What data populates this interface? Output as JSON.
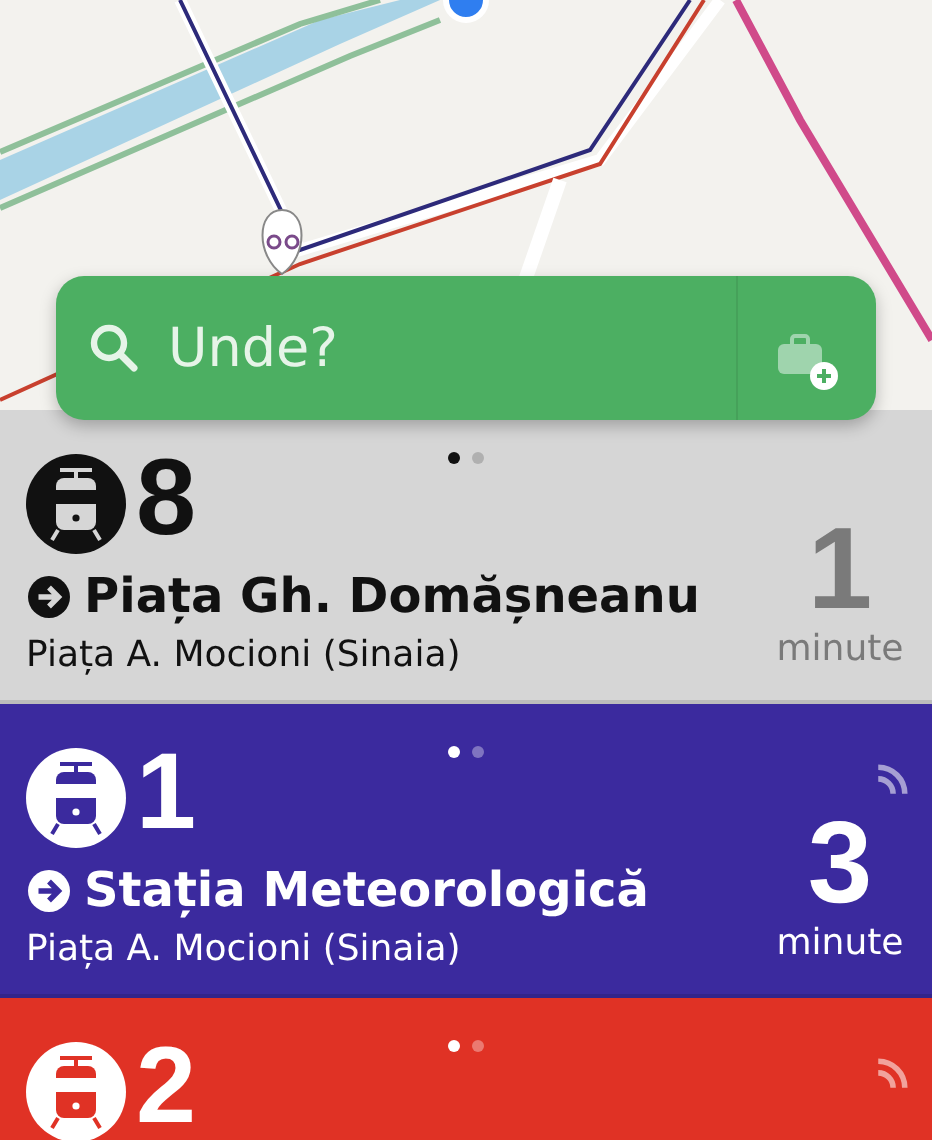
{
  "search": {
    "placeholder": "Unde?"
  },
  "departures": [
    {
      "line": "8",
      "destination": "Piața Gh. Domășneanu",
      "stop": "Piața A. Mocioni (Sinaia)",
      "minutes": "1",
      "unit": "minute",
      "color": "#d6d6d6",
      "realtime": false,
      "pages": [
        {
          "selected": true
        },
        {
          "selected": false
        }
      ]
    },
    {
      "line": "1",
      "destination": "Stația Meteorologică",
      "stop": "Piața A. Mocioni (Sinaia)",
      "minutes": "3",
      "unit": "minute",
      "color": "#3b2a9e",
      "realtime": true,
      "pages": [
        {
          "selected": true
        },
        {
          "selected": false
        }
      ]
    },
    {
      "line": "2",
      "color": "#e03225",
      "realtime": true,
      "pages": [
        {
          "selected": true
        },
        {
          "selected": false
        }
      ]
    }
  ]
}
